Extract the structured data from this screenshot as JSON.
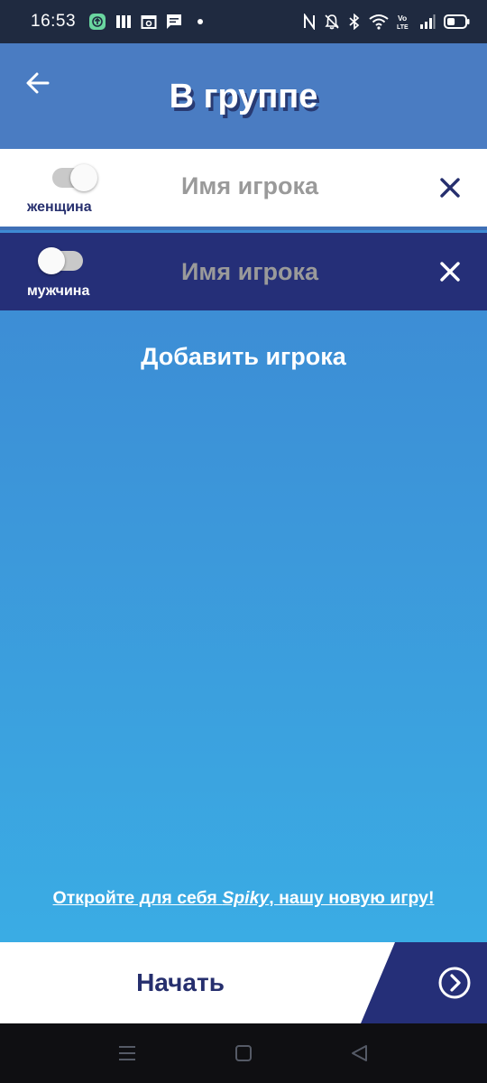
{
  "status_bar": {
    "time": "16:53",
    "left_icons": [
      "upload-app-icon",
      "apps-icon",
      "calendar-icon",
      "message-icon",
      "notification-dot-icon"
    ],
    "right_icons": [
      "nfc-icon",
      "mute-icon",
      "bluetooth-icon",
      "wifi-icon",
      "volte-icon",
      "signal-icon",
      "battery-icon"
    ],
    "volte_text": "Vo LTE",
    "battery_level": 0.45
  },
  "header": {
    "title": "В группе",
    "back_icon": "arrow-left-icon"
  },
  "players": [
    {
      "gender_label": "женщина",
      "toggle_on": true,
      "name_placeholder": "Имя игрока",
      "name_value": "",
      "remove_icon": "close-icon"
    },
    {
      "gender_label": "мужчина",
      "toggle_on": false,
      "name_placeholder": "Имя игрока",
      "name_value": "",
      "remove_icon": "close-icon"
    }
  ],
  "add_player_label": "Добавить игрока",
  "promo": {
    "prefix": "Откройте для себя ",
    "brand": "Spiky",
    "suffix": ", нашу новую игру!"
  },
  "start": {
    "label": "Начать",
    "arrow_icon": "chevron-right-circle-icon"
  },
  "nav_bar": {
    "icons": [
      "menu-icon",
      "home-icon",
      "back-icon"
    ]
  },
  "colors": {
    "header_bg": "#4a7cc2",
    "dark_row_bg": "#252f78",
    "title_shadow": "#283a72",
    "gradient_top": "#3f82cf",
    "gradient_bottom": "#3ab0e6",
    "accent_navy": "#262f6e"
  }
}
